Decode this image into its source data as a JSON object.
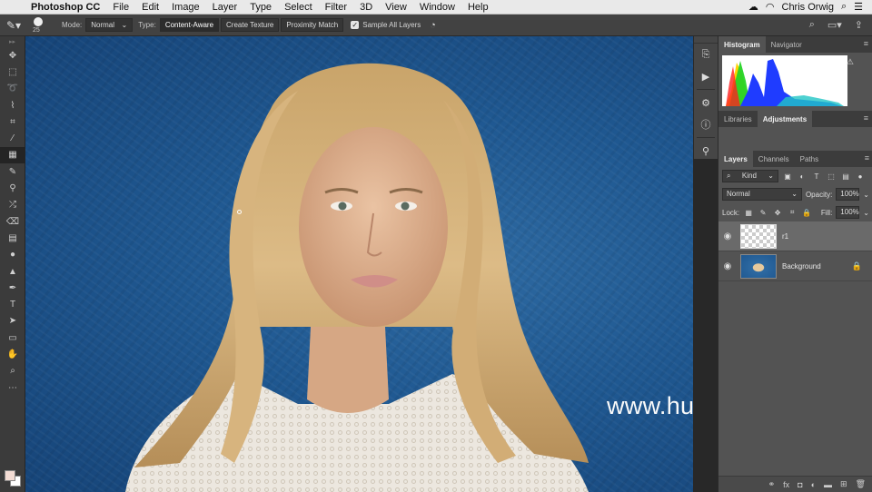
{
  "menubar": {
    "app": "Photoshop CC",
    "items": [
      "File",
      "Edit",
      "Image",
      "Layer",
      "Type",
      "Select",
      "Filter",
      "3D",
      "View",
      "Window",
      "Help"
    ],
    "user": "Chris Orwig"
  },
  "options": {
    "brush_size": "25",
    "mode_label": "Mode:",
    "mode_value": "Normal",
    "type_label": "Type:",
    "type_options": [
      "Content-Aware",
      "Create Texture",
      "Proximity Match"
    ],
    "sample_all_layers": "Sample All Layers"
  },
  "canvas": {
    "watermark": "www.hunls.com"
  },
  "panels": {
    "top_tabs": [
      "Histogram",
      "Navigator"
    ],
    "mid_tabs": [
      "Libraries",
      "Adjustments"
    ],
    "layer_tabs": [
      "Layers",
      "Channels",
      "Paths"
    ],
    "kind_label": "Kind",
    "blend_mode": "Normal",
    "opacity_label": "Opacity:",
    "opacity_value": "100%",
    "lock_label": "Lock:",
    "fill_label": "Fill:",
    "fill_value": "100%",
    "layers": [
      {
        "name": "r1"
      },
      {
        "name": "Background"
      }
    ]
  },
  "colors": {
    "accent_bg": "#535353",
    "foreground_swatch": "#f3dcd4",
    "background_swatch": "#ffffff"
  }
}
